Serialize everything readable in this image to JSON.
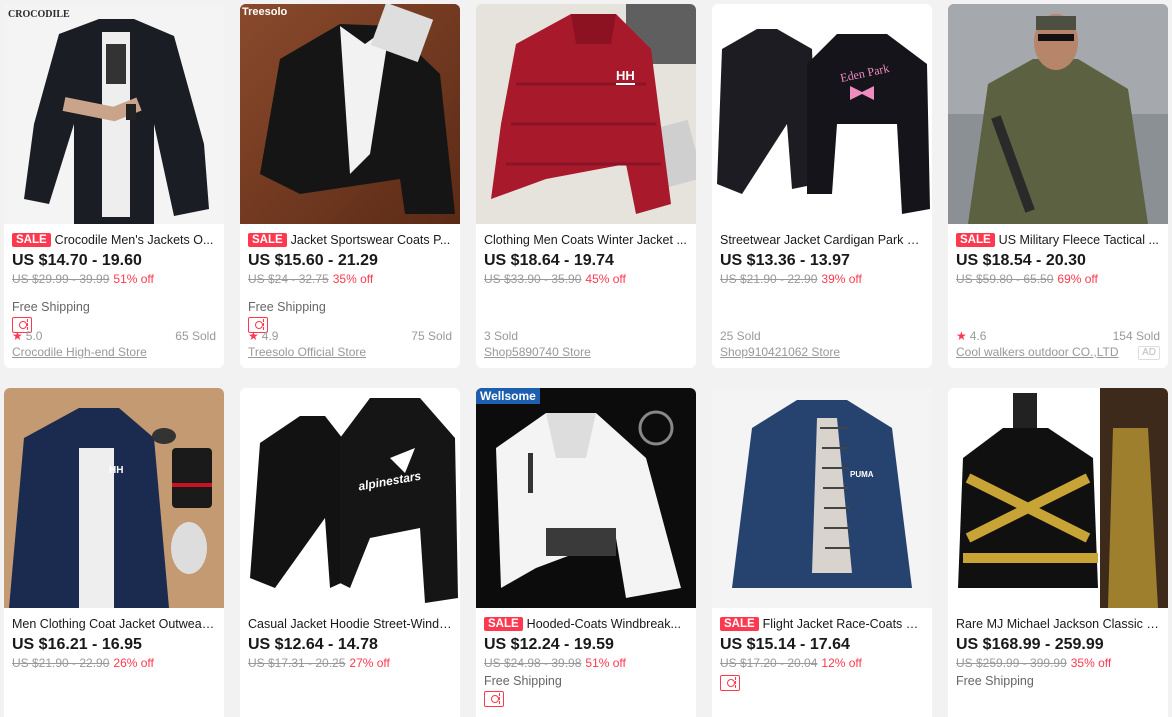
{
  "products": [
    {
      "title": "Crocodile Men's Jackets O...",
      "sale": "SALE",
      "price": "US $14.70 - 19.60",
      "original_price": "US $29.99 - 39.99",
      "discount": "51% off",
      "shipping": "Free Shipping",
      "rating": "5.0",
      "sold": "65 Sold",
      "store": "Crocodile High-end Store",
      "image_label": "CROCODILE"
    },
    {
      "title": "Jacket Sportswear Coats P...",
      "sale": "SALE",
      "price": "US $15.60 - 21.29",
      "original_price": "US $24 - 32.75",
      "discount": "35% off",
      "shipping": "Free Shipping",
      "rating": "4.9",
      "sold": "75 Sold",
      "store": "Treesolo Official Store",
      "image_label": "Treesolo"
    },
    {
      "title": "Clothing Men Coats Winter Jacket ...",
      "price": "US $18.64 - 19.74",
      "original_price": "US $33.90 - 35.90",
      "discount": "45% off",
      "sold": "3 Sold",
      "store": "Shop5890740 Store",
      "image_label": "HH"
    },
    {
      "title": "Streetwear Jacket Cardigan Park C...",
      "price": "US $13.36 - 13.97",
      "original_price": "US $21.90 - 22.90",
      "discount": "39% off",
      "sold": "25 Sold",
      "store": "Shop910421062 Store",
      "image_label": "Eden Park"
    },
    {
      "title": "US Military Fleece Tactical ...",
      "sale": "SALE",
      "price": "US $18.54 - 20.30",
      "original_price": "US $59.80 - 65.50",
      "discount": "69% off",
      "rating": "4.6",
      "sold": "154 Sold",
      "store": "Cool walkers outdoor CO.,LTD",
      "ad": "AD"
    },
    {
      "title": "Men Clothing Coat Jacket Outwear ...",
      "price": "US $16.21 - 16.95",
      "original_price": "US $21.90 - 22.90",
      "discount": "26% off",
      "image_label": "HH"
    },
    {
      "title": "Casual Jacket Hoodie Street-Windb...",
      "price": "US $12.64 - 14.78",
      "original_price": "US $17.31 - 20.25",
      "discount": "27% off",
      "image_label": "alpinestars"
    },
    {
      "title": "Hooded-Coats Windbreak...",
      "sale": "SALE",
      "price": "US $12.24 - 19.59",
      "original_price": "US $24.98 - 39.98",
      "discount": "51% off",
      "shipping": "Free Shipping",
      "image_label": "Wellsome"
    },
    {
      "title": "Flight Jacket Race-Coats M...",
      "sale": "SALE",
      "price": "US $15.14 - 17.64",
      "original_price": "US $17.20 - 20.04",
      "discount": "12% off",
      "image_label": "PUMA"
    },
    {
      "title": "Rare MJ Michael Jackson Classic JA...",
      "price": "US $168.99 - 259.99",
      "original_price": "US $259.99 - 399.99",
      "discount": "35% off",
      "shipping": "Free Shipping"
    }
  ],
  "colors": {
    "accent": "#fd384f",
    "page_bg": "#f2f2f2",
    "muted": "#999999"
  },
  "icons": {
    "coupon": "coupon-icon",
    "star": "star-icon"
  }
}
